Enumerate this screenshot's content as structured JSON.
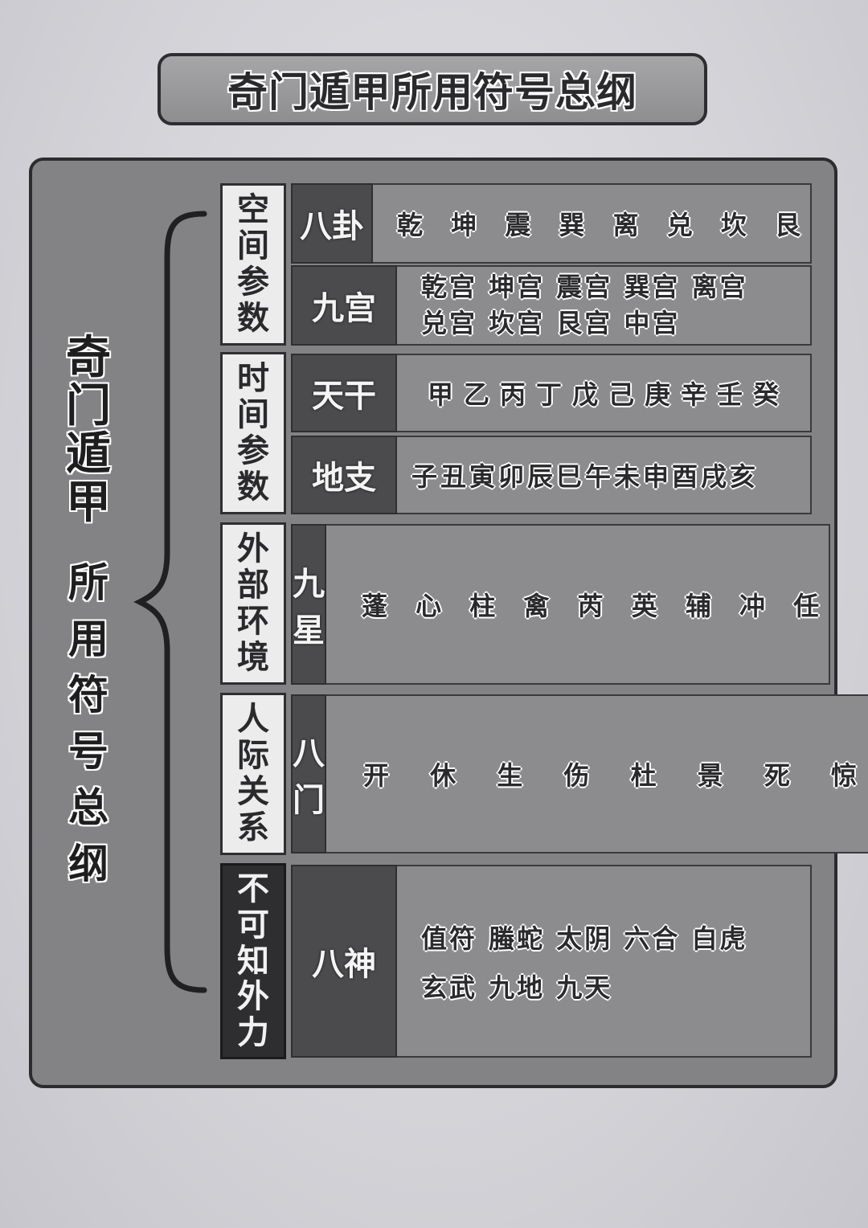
{
  "title": "奇门遁甲所用符号总纲",
  "side_title_top": [
    "奇",
    "门",
    "遁",
    "甲"
  ],
  "side_title_bottom": [
    "所",
    "用",
    "符",
    "号",
    "总",
    "纲"
  ],
  "categories": [
    {
      "chars": [
        "空",
        "间",
        "参",
        "数"
      ]
    },
    {
      "chars": [
        "时",
        "间",
        "参",
        "数"
      ]
    },
    {
      "chars": [
        "外",
        "部",
        "环",
        "境"
      ]
    },
    {
      "chars": [
        "人",
        "际",
        "关",
        "系"
      ]
    },
    {
      "chars": [
        "不",
        "可",
        "知",
        "外",
        "力"
      ]
    }
  ],
  "rows": [
    {
      "label": "八卦",
      "lines": [
        "乾 坤 震 巽 离 兑 坎 艮"
      ]
    },
    {
      "label": "九宫",
      "lines": [
        "乾宫 坤宫 震宫 巽宫 离宫",
        "兑宫 坎宫 艮宫 中宫"
      ]
    },
    {
      "label": "天干",
      "lines": [
        "甲乙丙丁戊己庚辛壬癸"
      ]
    },
    {
      "label": "地支",
      "lines": [
        "子丑寅卯辰巳午未申酉戌亥"
      ]
    },
    {
      "label": "九星",
      "lines": [
        "蓬 心 柱 禽 芮 英 辅 冲 任"
      ]
    },
    {
      "label": "八门",
      "lines": [
        "开 休 生 伤 杜 景 死 惊"
      ]
    },
    {
      "label": "八神",
      "lines": [
        "值符 螣蛇 太阴 六合 白虎",
        "玄武 九地 九天"
      ]
    }
  ]
}
